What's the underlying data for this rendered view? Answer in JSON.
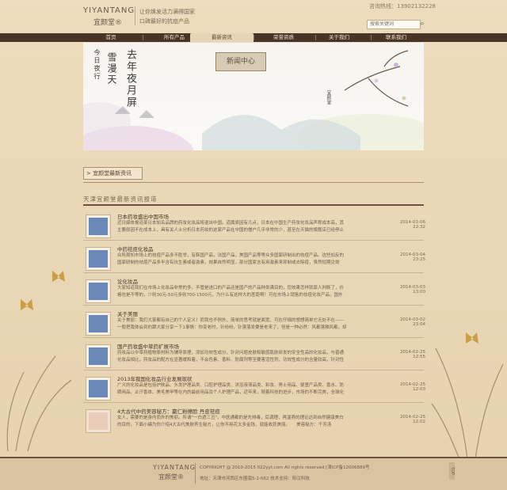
{
  "header": {
    "logo_en": "YIYANTANG",
    "logo_cn": "宜颜堂®",
    "slogan_1": "让你焕发活力满得国家",
    "slogan_2": "口碑最好的抗痘产品",
    "hotline": "咨询热线：13902132228",
    "search_placeholder": "搜索关键词",
    "search_icon": "search-icon"
  },
  "nav": {
    "items": [
      {
        "label": "首页"
      },
      {
        "label": "所有产品"
      },
      {
        "label": "最新资讯"
      },
      {
        "label": "荣誉资质"
      },
      {
        "label": "关于我们"
      },
      {
        "label": "联系我们"
      }
    ],
    "active_index": 2
  },
  "banner": {
    "board_title": "新闻中心",
    "calligraphy_1": "去年夜月屏",
    "calligraphy_2": "雪漫天",
    "calligraphy_3": "今日夜行",
    "seal": "宜颜堂"
  },
  "breadcrumb": "> 宜颜堂最新资讯",
  "section_title": "天津宜颜堂最新资讯报道",
  "news": [
    {
      "title": "日本药妆盛出中国市场",
      "desc": "近日媒体报道某日本知名品牌的药妆化妆品将退出中国。道属原因有几点，日本在中国生产药妆化妆品声称成本高，其主要原因不在成本上，具有关人士分析日本药妆的这家产品在中国的僧户几乎非常的少，甚至在天猫的旗舰店已经停止销售了。并",
      "date": "2014-03-06 22:32"
    },
    {
      "title": "中药祛痘化妆品",
      "desc": "众所周知市场上的祛痘产品多不胜举，有韩国产品，法国产品，美国产品等等众多国家研制出的祛痘产品。这些加反的国家研制的祛痘产品多半含有抗生素或者激素，效果自然明显，部分国家含有用激素来抑制或去除痘，虽然短期见效快，但副作用显著，所以下面",
      "date": "2014-03-04 23:25"
    },
    {
      "title": "论化妆品",
      "desc": "大家知道我们在市场上化妆品非常的多，不管是进口的产品还是国产的产品种类满目的，您效果怎样就靠人判断了，价格也是不等的，少则30元-50元多则700-1500元，为什么有这样大的差距啊！可在市场上销售的祛痘化妆产品，国外",
      "date": "2014-03-03 13:00"
    },
    {
      "title": "关于美丽",
      "desc": "关于美丽：我们大家都有自己的个人定义！而我也不例外，简单的思考就是面宽、可在仔细的想想简单它无处不在——一般把我体会到的跟大家分享一下1事情：你变老时，针纷纷，针落落发要是老来了，但是一种必然：风都落雅风都，却是一事时们，要",
      "date": "2014-03-02 23:04"
    },
    {
      "title": "国产药妆盛中草药扩展市场",
      "desc": "药妆品以中草药植物原材料为辅导原理，添加功效性成分，针对问题皮肤和敏感肌肤研发的安全性高的化妆品，与普通化妆品相比，药妆品的配方在显著缓和着，不会色素、香料、防腐剂等至要害活性剂，功效性成分的含量较高，针对性强，在皮肤护理",
      "date": "2014-02-25 12:55"
    },
    {
      "title": "2013年我国化妆品行业发展现状",
      "desc": "广义的化妆品是包括护肤品、头发护理品类、口腔护理品类、沐浴液清品类、彩妆、男士用品、婴童产品类、香水、防晒用品、止汗香体、美毛美甲等在内的最前用品及个人护理产品，近年来，随着科技的进步，市场的不断完美，全球化妆品消费需",
      "date": "2014-02-25 12:03"
    },
    {
      "title": "4大古代中药美容秘方：赢仁粉擦脸 丹皮祛痘",
      "desc": "女人，需要的是身内而外的美丽。所谓\"一白遮三丑\"，中医通都的是先排毒，后调理，再温养的理论达到自然健康美白的目的，下面小编为你介绍4大古代美肤养生秘方，让你不用花太多金钱，就能收获美丽。　　美容秘方：千芳汤",
      "date": "2014-02-25 12:02"
    }
  ],
  "footer": {
    "logo_en": "YIYANTANG",
    "logo_cn": "宜颜堂®",
    "copyright": "COPYRIGHT @ 2010-2015 022yyt.com All rights reserved [津ICP备12006889号",
    "address": "地址：天津市河西区东围南5-2-662  技术支持：阳汉科技",
    "top_label": "TOP"
  }
}
